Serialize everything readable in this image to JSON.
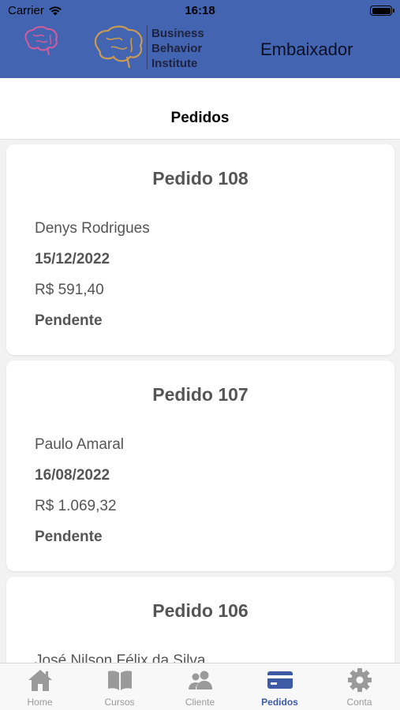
{
  "status_bar": {
    "carrier": "Carrier",
    "time": "16:18"
  },
  "header": {
    "brand_lines": [
      "Business",
      "Behavior",
      "Institute"
    ],
    "title": "Embaixador",
    "accent_color": "#4264b1"
  },
  "page": {
    "title": "Pedidos"
  },
  "orders": [
    {
      "title": "Pedido 108",
      "client": "Denys Rodrigues",
      "date": "15/12/2022",
      "amount": "R$ 591,40",
      "status": "Pendente"
    },
    {
      "title": "Pedido 107",
      "client": "Paulo Amaral",
      "date": "16/08/2022",
      "amount": "R$ 1.069,32",
      "status": "Pendente"
    },
    {
      "title": "Pedido 106",
      "client": "José Nilson Félix da Silva"
    }
  ],
  "tabs": [
    {
      "label": "Home",
      "icon": "home-icon"
    },
    {
      "label": "Cursos",
      "icon": "book-icon"
    },
    {
      "label": "Cliente",
      "icon": "people-icon"
    },
    {
      "label": "Pedidos",
      "icon": "card-icon",
      "active": true
    },
    {
      "label": "Conta",
      "icon": "gear-icon"
    }
  ]
}
